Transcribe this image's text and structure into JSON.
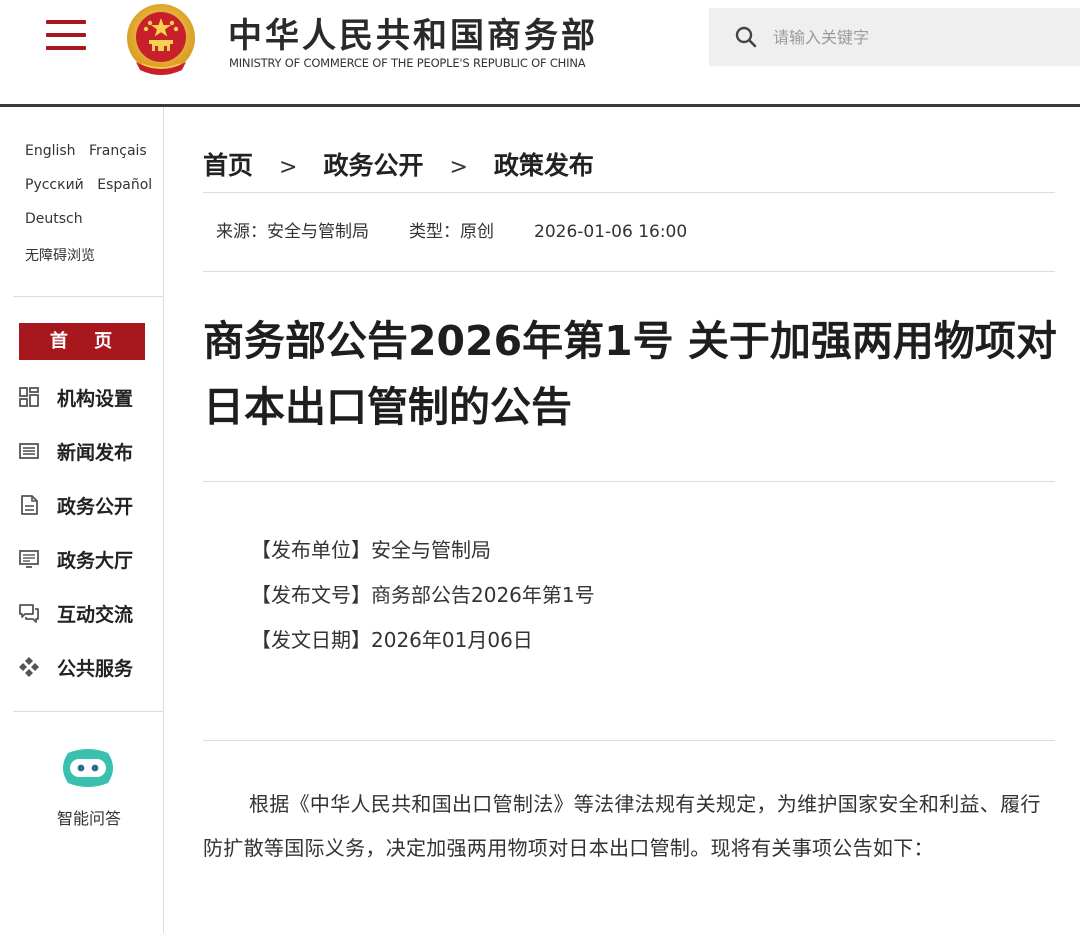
{
  "header": {
    "site_title_cn": "中华人民共和国商务部",
    "site_title_en": "MINISTRY OF COMMERCE OF THE PEOPLE'S REPUBLIC OF CHINA",
    "search_placeholder": "请输入关键字"
  },
  "sidebar": {
    "languages": [
      "English",
      "Français",
      "Русский",
      "Español",
      "Deutsch"
    ],
    "accessibility": "无障碍浏览",
    "home_label": "首 页",
    "nav_items": [
      {
        "label": "机构设置",
        "icon": "grid-icon"
      },
      {
        "label": "新闻发布",
        "icon": "newspaper-icon"
      },
      {
        "label": "政务公开",
        "icon": "document-icon"
      },
      {
        "label": "政务大厅",
        "icon": "monitor-icon"
      },
      {
        "label": "互动交流",
        "icon": "chat-icon"
      },
      {
        "label": "公共服务",
        "icon": "service-icon"
      }
    ],
    "assistant_label": "智能问答"
  },
  "breadcrumb": {
    "items": [
      "首页",
      "政务公开",
      "政策发布"
    ],
    "separator": ">"
  },
  "meta": {
    "source": "来源：安全与管制局",
    "type": "类型：原创",
    "datetime": "2026-01-06 16:00"
  },
  "article": {
    "title": "商务部公告2026年第1号 关于加强两用物项对日本出口管制的公告",
    "issuer": "【发布单位】安全与管制局",
    "doc_number": "【发布文号】商务部公告2026年第1号",
    "issue_date": "【发文日期】2026年01月06日",
    "body": "根据《中华人民共和国出口管制法》等法律法规有关规定，为维护国家安全和利益、履行防扩散等国际义务，决定加强两用物项对日本出口管制。现将有关事项公告如下："
  },
  "colors": {
    "accent_red": "#a8171d",
    "search_bg": "#efefef",
    "assistant_teal": "#3bbfae"
  }
}
